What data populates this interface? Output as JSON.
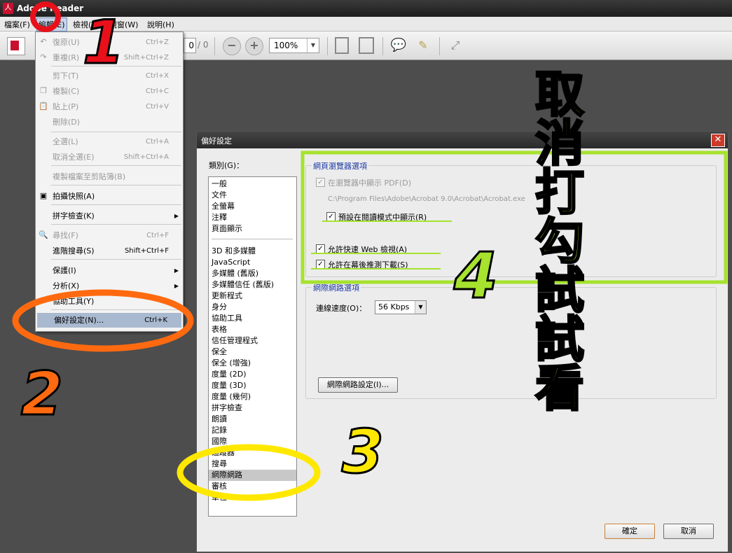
{
  "window": {
    "title": "Adobe Reader"
  },
  "menubar": {
    "file": "檔案(F)",
    "edit": "編輯(E)",
    "view": "檢視(V)",
    "window": "視窗(W)",
    "help": "說明(H)"
  },
  "toolbar": {
    "page_value": "0",
    "page_total": "/ 0",
    "zoom": "100%"
  },
  "menu": {
    "items": [
      {
        "label": "復原(U)",
        "shortcut": "Ctrl+Z",
        "disabled": true
      },
      {
        "label": "重複(R)",
        "shortcut": "Shift+Ctrl+Z",
        "disabled": true
      },
      {
        "label": "剪下(T)",
        "shortcut": "Ctrl+X",
        "disabled": true
      },
      {
        "label": "複製(C)",
        "shortcut": "Ctrl+C",
        "disabled": true
      },
      {
        "label": "貼上(P)",
        "shortcut": "Ctrl+V",
        "disabled": true
      },
      {
        "label": "刪除(D)",
        "shortcut": "",
        "disabled": true
      },
      {
        "label": "全選(L)",
        "shortcut": "Ctrl+A",
        "disabled": true
      },
      {
        "label": "取消全選(E)",
        "shortcut": "Shift+Ctrl+A",
        "disabled": true
      },
      {
        "label": "複製檔案至剪貼簿(B)",
        "shortcut": "",
        "disabled": true
      },
      {
        "label": "拍攝快照(A)",
        "shortcut": "",
        "disabled": false
      },
      {
        "label": "拼字檢查(K)",
        "shortcut": "",
        "disabled": false
      },
      {
        "label": "尋找(F)",
        "shortcut": "Ctrl+F",
        "disabled": true
      },
      {
        "label": "進階搜尋(S)",
        "shortcut": "Shift+Ctrl+F",
        "disabled": false
      },
      {
        "label": "保護(I)",
        "shortcut": "",
        "disabled": false
      },
      {
        "label": "分析(X)",
        "shortcut": "",
        "disabled": false
      },
      {
        "label": "協助工具(Y)",
        "shortcut": "",
        "disabled": false
      },
      {
        "label": "偏好設定(N)...",
        "shortcut": "Ctrl+K",
        "disabled": false
      }
    ]
  },
  "dialog": {
    "title": "偏好設定",
    "category_label": "類別(G)：",
    "categories_top": [
      "一般",
      "文件",
      "全螢幕",
      "注釋",
      "頁面顯示"
    ],
    "categories": [
      "3D 和多媒體",
      "JavaScript",
      "多媒體 (舊版)",
      "多媒體信任 (舊版)",
      "更新程式",
      "身分",
      "協助工具",
      "表格",
      "信任管理程式",
      "保全",
      "保全 (增強)",
      "度量 (2D)",
      "度量 (3D)",
      "度量 (幾何)",
      "拼字檢查",
      "朗讀",
      "記錄",
      "國際",
      "追蹤器",
      "搜尋",
      "網際網路",
      "審核",
      "單位"
    ],
    "browser_group": {
      "title": "網頁瀏覽器選項",
      "show_in_browser": "在瀏覽器中顯示 PDF(D)",
      "path": "C:\\Program Files\\Adobe\\Acrobat 9.0\\Acrobat\\Acrobat.exe",
      "read_mode": "預設在閱讀模式中顯示(R)",
      "fast_web_view": "允許快速 Web 檢視(A)",
      "background_download": "允許在幕後推測下載(S)"
    },
    "internet_group": {
      "title": "網際網路選項",
      "speed_label": "連線速度(O)：",
      "speed_value": "56 Kbps",
      "settings_button": "網際網路設定(I)..."
    },
    "ok": "確定",
    "cancel": "取消"
  },
  "annotations": {
    "n1": "1",
    "n2": "2",
    "n3": "3",
    "n4": "4",
    "note": [
      "取",
      "消",
      "打",
      "勾",
      "試",
      "試",
      "看"
    ]
  },
  "colors": {
    "red": "#e8101a",
    "orange": "#ff6a10",
    "yellow": "#ffe800",
    "green": "#a6e22e"
  }
}
